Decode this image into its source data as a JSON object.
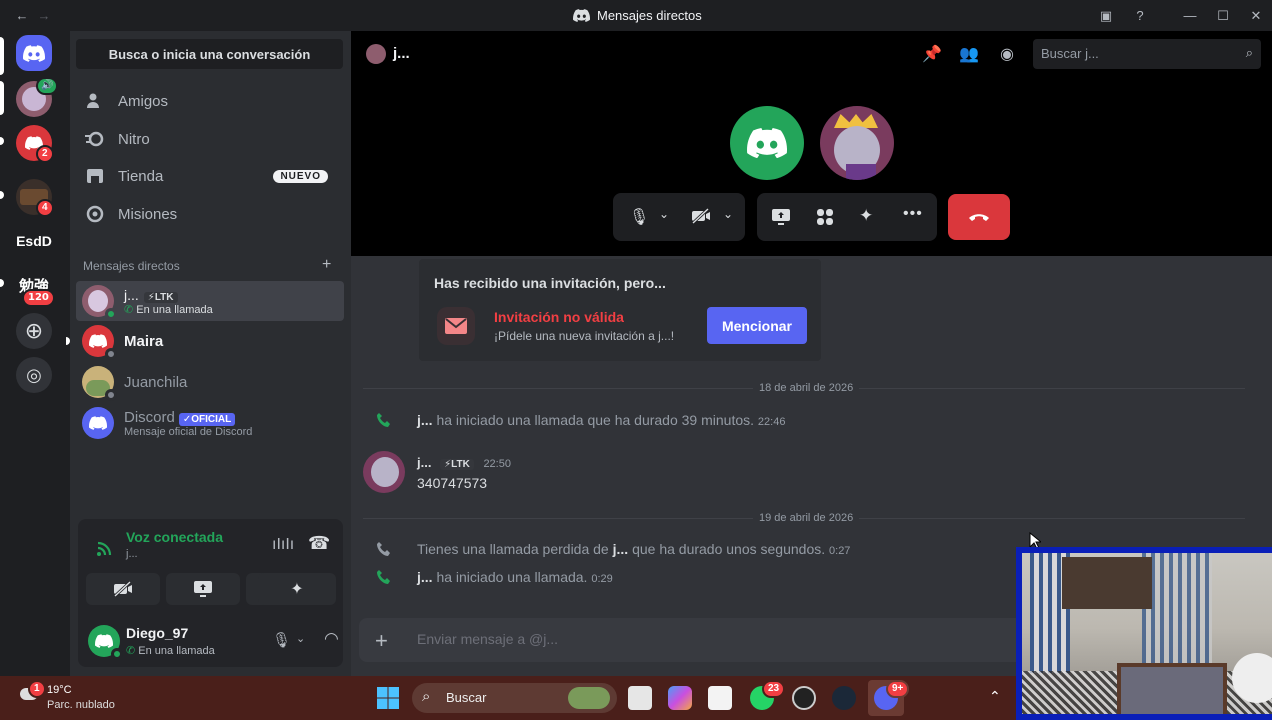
{
  "window": {
    "title": "Mensajes directos"
  },
  "rail": {
    "servers": [
      {
        "label": "",
        "badge": ""
      },
      {
        "label": "",
        "badge": ""
      },
      {
        "label": "",
        "badge": "2"
      },
      {
        "label": "",
        "badge": "4"
      },
      {
        "label": "EsdD",
        "badge": ""
      },
      {
        "label": "勉強",
        "badge": "120"
      }
    ]
  },
  "sidebar": {
    "search_label": "Busca o inicia una conversación",
    "nav": [
      {
        "label": "Amigos"
      },
      {
        "label": "Nitro"
      },
      {
        "label": "Tienda",
        "badge": "NUEVO"
      },
      {
        "label": "Misiones"
      }
    ],
    "dm_header": "Mensajes directos",
    "dms": [
      {
        "name": "j...",
        "tag": "LTK",
        "sub": "En una llamada"
      },
      {
        "name": "Maira",
        "tag": "",
        "sub": ""
      },
      {
        "name": "Juanchila",
        "tag": "",
        "sub": ""
      },
      {
        "name": "Discord",
        "tag": "OFICIAL",
        "sub": "Mensaje oficial de Discord"
      }
    ]
  },
  "voice_panel": {
    "status": "Voz conectada",
    "channel": "j..."
  },
  "user": {
    "name": "Diego_97",
    "status": "En una llamada"
  },
  "chat": {
    "channel_name": "j...",
    "search_placeholder": "Buscar j...",
    "invite": {
      "title": "Has recibido una invitación, pero...",
      "invalid_title": "Invitación no válida",
      "invalid_sub": "¡Pídele una nueva invitación a j...!",
      "button": "Mencionar"
    },
    "date1": "18 de abril de 2026",
    "sys1": {
      "user": "j...",
      "text": "ha iniciado una llamada que ha durado 39 minutos.",
      "time": "22:46"
    },
    "msg": {
      "user": "j...",
      "tag": "LTK",
      "time": "22:50",
      "text": "340747573"
    },
    "date2": "19 de abril de 2026",
    "sys2": {
      "pre": "Tienes una llamada perdida de",
      "user": "j...",
      "text": "que ha durado unos segundos.",
      "time": "0:27"
    },
    "sys3": {
      "user": "j...",
      "text": "ha iniciado una llamada.",
      "time": "0:29"
    },
    "composer_placeholder": "Enviar mensaje a @j..."
  },
  "taskbar": {
    "weather_temp": "19°C",
    "weather_desc": "Parc. nublado",
    "weather_badge": "1",
    "search": "Buscar",
    "whatsapp_badge": "23",
    "discord_badge": "9+"
  },
  "colors": {
    "blurple": "#5865f2",
    "green": "#23a55a",
    "red": "#da373c"
  }
}
